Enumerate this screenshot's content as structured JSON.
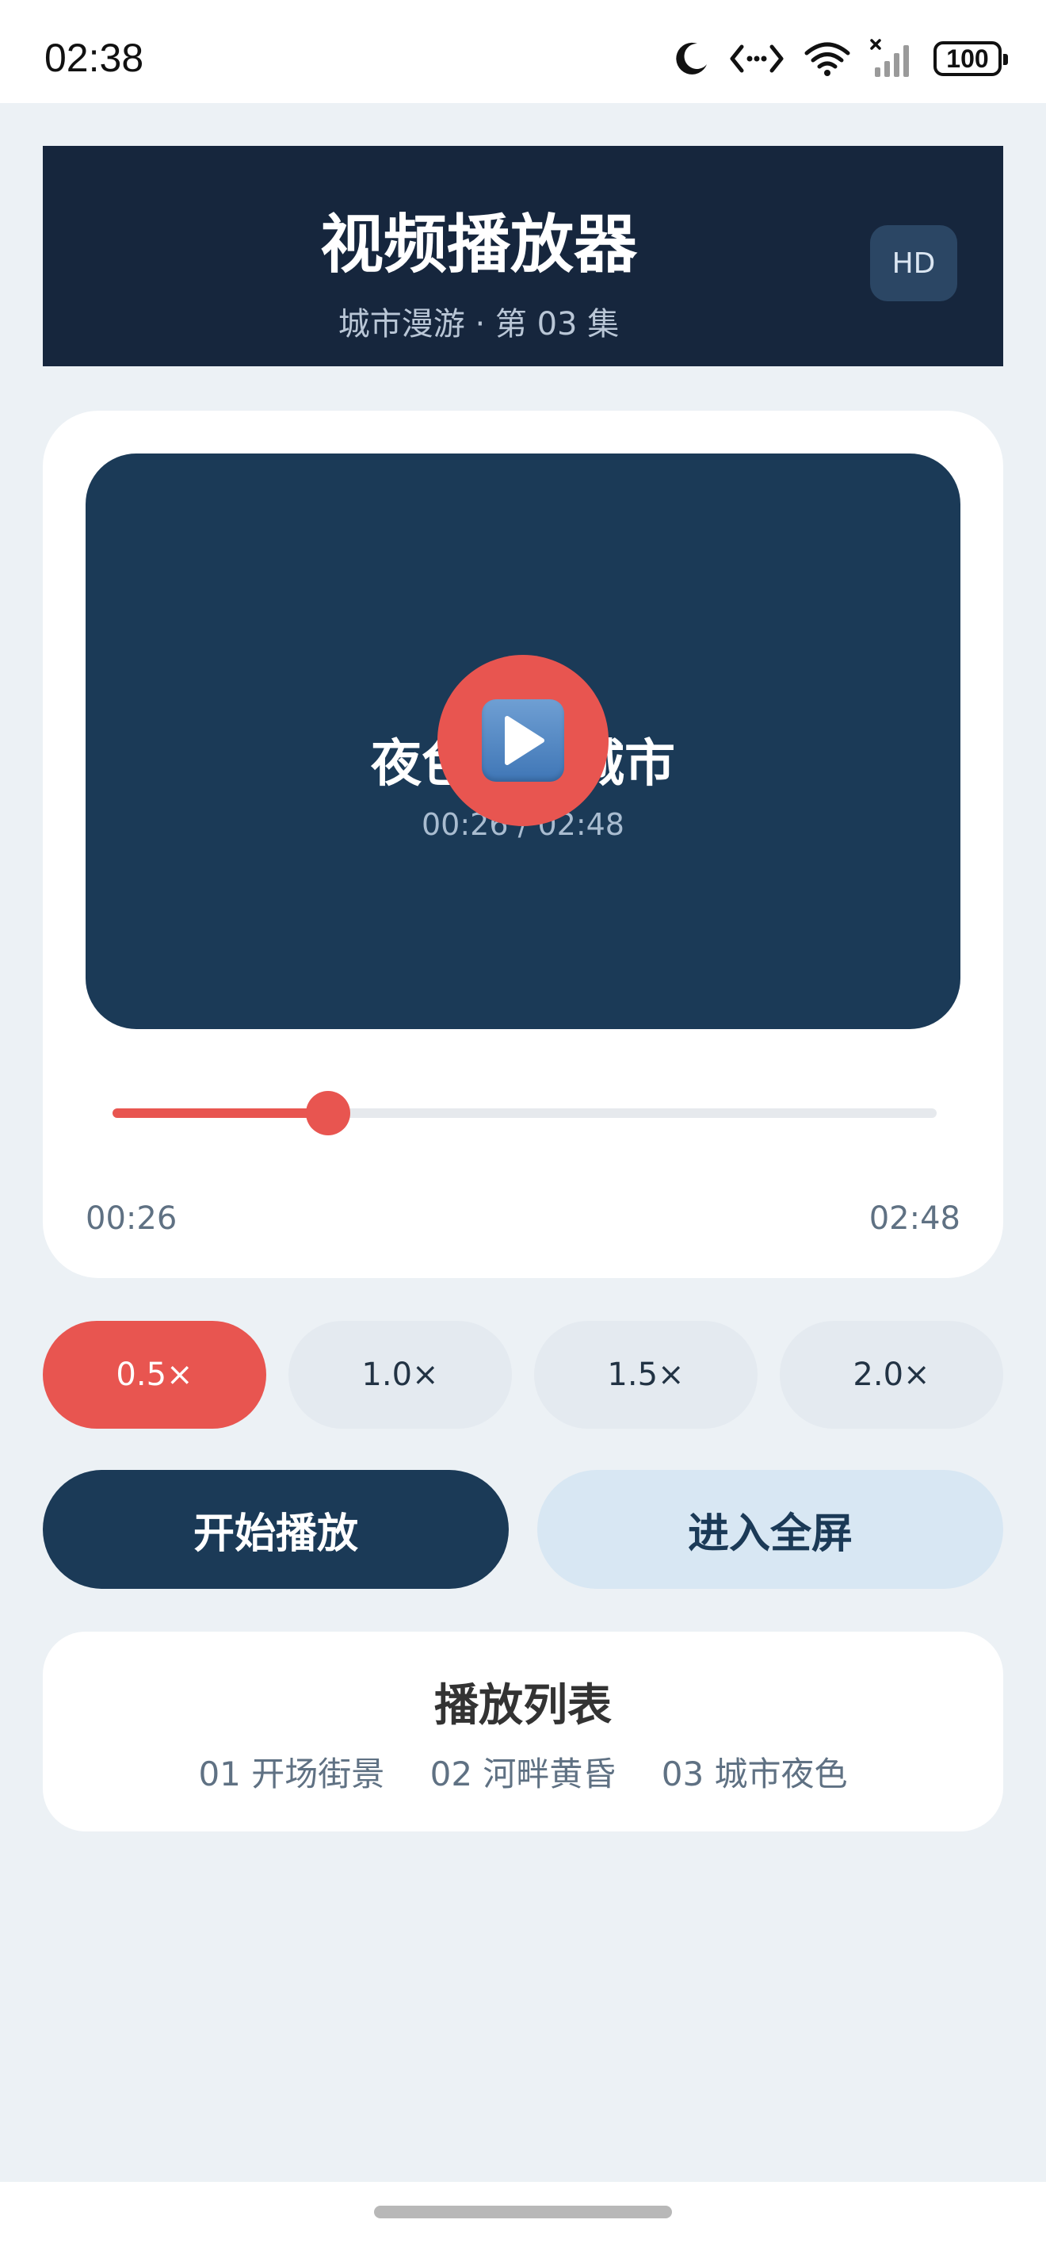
{
  "status_bar": {
    "time": "02:38",
    "battery": "100",
    "icons": [
      "moon-icon",
      "data-transfer-icon",
      "wifi-icon",
      "signal-icon",
      "battery-icon"
    ]
  },
  "header": {
    "title": "视频播放器",
    "subtitle": "城市漫游 · 第 03 集",
    "badge": "HD"
  },
  "player": {
    "video_title": "夜色中的城市",
    "video_time": "00:26 / 02:48",
    "current_time": "00:26",
    "total_time": "02:48",
    "progress_fraction": 0.262,
    "play_icon": "play-icon"
  },
  "speeds": {
    "options": [
      "0.5×",
      "1.0×",
      "1.5×",
      "2.0×"
    ],
    "selected_index": 0
  },
  "actions": {
    "play_label": "开始播放",
    "fullscreen_label": "进入全屏"
  },
  "playlist": {
    "title": "播放列表",
    "items": [
      "01  开场街景",
      "02  河畔黄昏",
      "03  城市夜色"
    ]
  },
  "colors": {
    "accent": "#e85550",
    "navy": "#16263d",
    "video_bg": "#1b3a57",
    "page_bg": "#ecf1f5"
  }
}
